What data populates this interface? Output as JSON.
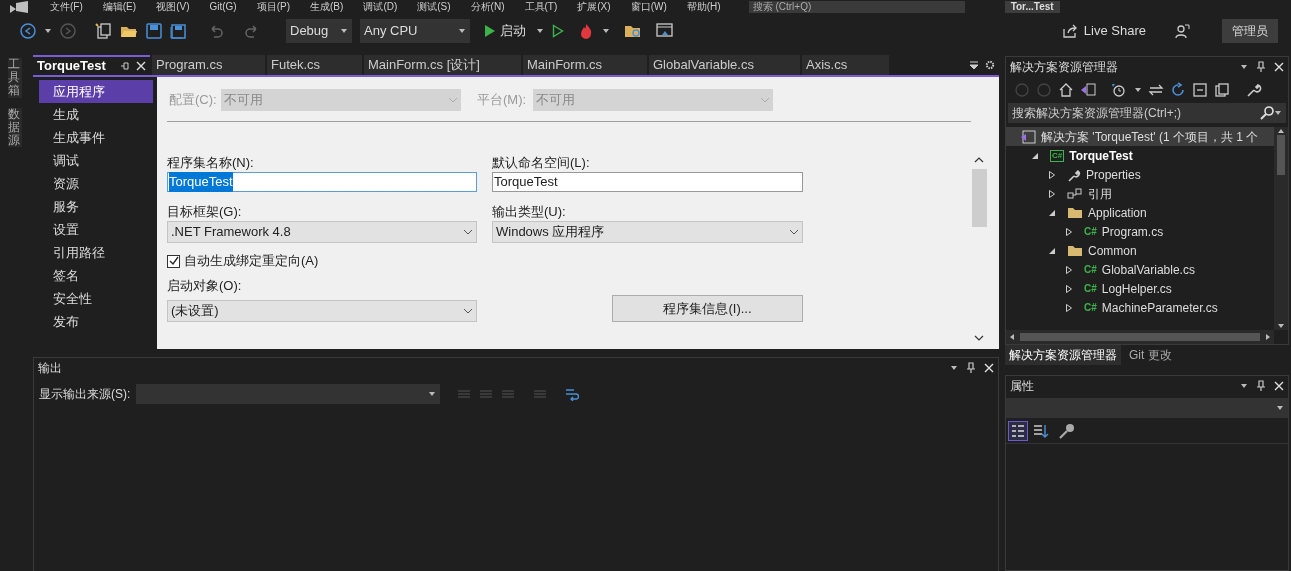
{
  "menu": [
    "文件(F)",
    "编辑(E)",
    "视图(V)",
    "Git(G)",
    "项目(P)",
    "生成(B)",
    "调试(D)",
    "测试(S)",
    "分析(N)",
    "工具(T)",
    "扩展(X)",
    "窗口(W)",
    "帮助(H)"
  ],
  "title_search": {
    "placeholder": "搜索 (Ctrl+Q)"
  },
  "window_title": "Tor...Test",
  "toolbar": {
    "configuration": "Debug",
    "platform": "Any CPU",
    "start": "启动",
    "live_share": "Live Share",
    "admin": "管理员"
  },
  "side_tabs": [
    "工具箱",
    "数据源"
  ],
  "doc_tabs": [
    {
      "label": "TorqueTest",
      "selected": true
    },
    {
      "label": "Program.cs",
      "selected": false
    },
    {
      "label": "Futek.cs",
      "selected": false
    },
    {
      "label": "MainForm.cs [设计]",
      "selected": false
    },
    {
      "label": "MainForm.cs",
      "selected": false
    },
    {
      "label": "GlobalVariable.cs",
      "selected": false
    },
    {
      "label": "Axis.cs",
      "selected": false
    }
  ],
  "project_nav": [
    {
      "label": "应用程序",
      "selected": true
    },
    {
      "label": "生成",
      "selected": false
    },
    {
      "label": "生成事件",
      "selected": false
    },
    {
      "label": "调试",
      "selected": false
    },
    {
      "label": "资源",
      "selected": false
    },
    {
      "label": "服务",
      "selected": false
    },
    {
      "label": "设置",
      "selected": false
    },
    {
      "label": "引用路径",
      "selected": false
    },
    {
      "label": "签名",
      "selected": false
    },
    {
      "label": "安全性",
      "selected": false
    },
    {
      "label": "发布",
      "selected": false
    }
  ],
  "app_page": {
    "config_label": "配置(C):",
    "config_value": "不可用",
    "platform_label": "平台(M):",
    "platform_value": "不可用",
    "assembly_name_label": "程序集名称(N):",
    "assembly_name": "TorqueTest",
    "namespace_label": "默认命名空间(L):",
    "namespace": "TorqueTest",
    "framework_label": "目标框架(G):",
    "framework": ".NET Framework 4.8",
    "output_type_label": "输出类型(U):",
    "output_type": "Windows 应用程序",
    "auto_redirect": {
      "label": "自动生成绑定重定向(A)",
      "checked": true
    },
    "startup_label": "启动对象(O):",
    "startup": "(未设置)",
    "assembly_info_button": "程序集信息(I)..."
  },
  "output": {
    "title": "输出",
    "source_label": "显示输出来源(S):"
  },
  "solution_explorer": {
    "title": "解决方案资源管理器",
    "search_placeholder": "搜索解决方案资源管理器(Ctrl+;)",
    "tree": [
      {
        "label": "解决方案 'TorqueTest' (1 个项目，共 1 个",
        "kind": "solution",
        "selected": true,
        "children": [
          {
            "label": "TorqueTest",
            "kind": "project",
            "icon_label": "C#",
            "expanded": true,
            "selected": false,
            "children": [
              {
                "label": "Properties",
                "kind": "properties",
                "expanded": false,
                "selected": false
              },
              {
                "label": "引用",
                "kind": "references",
                "expanded": false,
                "selected": false
              },
              {
                "label": "Application",
                "kind": "folder",
                "expanded": true,
                "selected": false,
                "children": [
                  {
                    "label": "Program.cs",
                    "kind": "csharp",
                    "icon_label": "C#",
                    "expanded": false,
                    "selected": false
                  }
                ]
              },
              {
                "label": "Common",
                "kind": "folder",
                "expanded": true,
                "selected": false,
                "children": [
                  {
                    "label": "GlobalVariable.cs",
                    "kind": "csharp",
                    "icon_label": "C#",
                    "expanded": false,
                    "selected": false
                  },
                  {
                    "label": "LogHelper.cs",
                    "kind": "csharp",
                    "icon_label": "C#",
                    "expanded": false,
                    "selected": false
                  },
                  {
                    "label": "MachineParameter.cs",
                    "kind": "csharp",
                    "icon_label": "C#",
                    "expanded": false,
                    "selected": false
                  }
                ]
              }
            ]
          }
        ]
      }
    ]
  },
  "bottom_tabs": [
    {
      "label": "解决方案资源管理器",
      "selected": true
    },
    {
      "label": "Git 更改",
      "selected": false
    }
  ],
  "properties": {
    "title": "属性"
  }
}
